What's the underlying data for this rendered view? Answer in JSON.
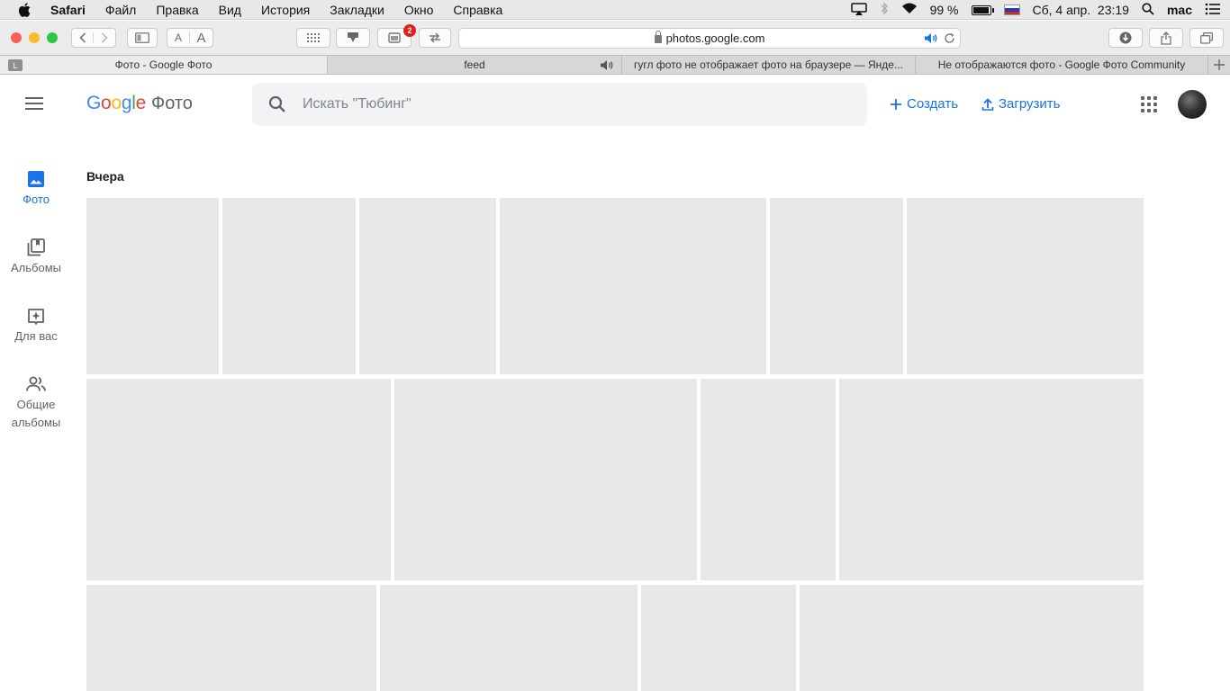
{
  "menubar": {
    "app_name": "Safari",
    "items": [
      "Файл",
      "Правка",
      "Вид",
      "История",
      "Закладки",
      "Окно",
      "Справка"
    ],
    "battery": "99 %",
    "datetime": "Сб, 4 апр.  23:19",
    "user": "mac"
  },
  "toolbar": {
    "reader_small": "A",
    "reader_large": "A",
    "badge": "2",
    "url": "photos.google.com"
  },
  "tabs": [
    {
      "label": "Фото - Google Фото",
      "active": true
    },
    {
      "label": "feed",
      "active": false
    },
    {
      "label": "гугл фото не отображает фото на браузере — Янде...",
      "active": false
    },
    {
      "label": "Не отображаются фото - Google Фото Community",
      "active": false
    }
  ],
  "pinned_tab_letter": "L",
  "header": {
    "logo_letters": [
      "G",
      "o",
      "o",
      "g",
      "l",
      "e"
    ],
    "logo_colors": [
      "#4285F4",
      "#EA4335",
      "#FBBC05",
      "#4285F4",
      "#34A853",
      "#EA4335"
    ],
    "product": "Фото",
    "search_placeholder": "Искать \"Тюбинг\"",
    "create_label": "Создать",
    "upload_label": "Загрузить"
  },
  "sidebar": {
    "items": [
      {
        "label": "Фото",
        "icon": "photo-icon",
        "active": true
      },
      {
        "label": "Альбомы",
        "icon": "albums-icon",
        "active": false
      },
      {
        "label": "Для вас",
        "icon": "for-you-icon",
        "active": false
      },
      {
        "label": "Общие альбомы",
        "icon": "shared-albums-icon",
        "active": false
      }
    ]
  },
  "main": {
    "section_title": "Вчера"
  },
  "colors": {
    "accent": "#1a73e8",
    "placeholder_tile": "#e8e8ea"
  }
}
